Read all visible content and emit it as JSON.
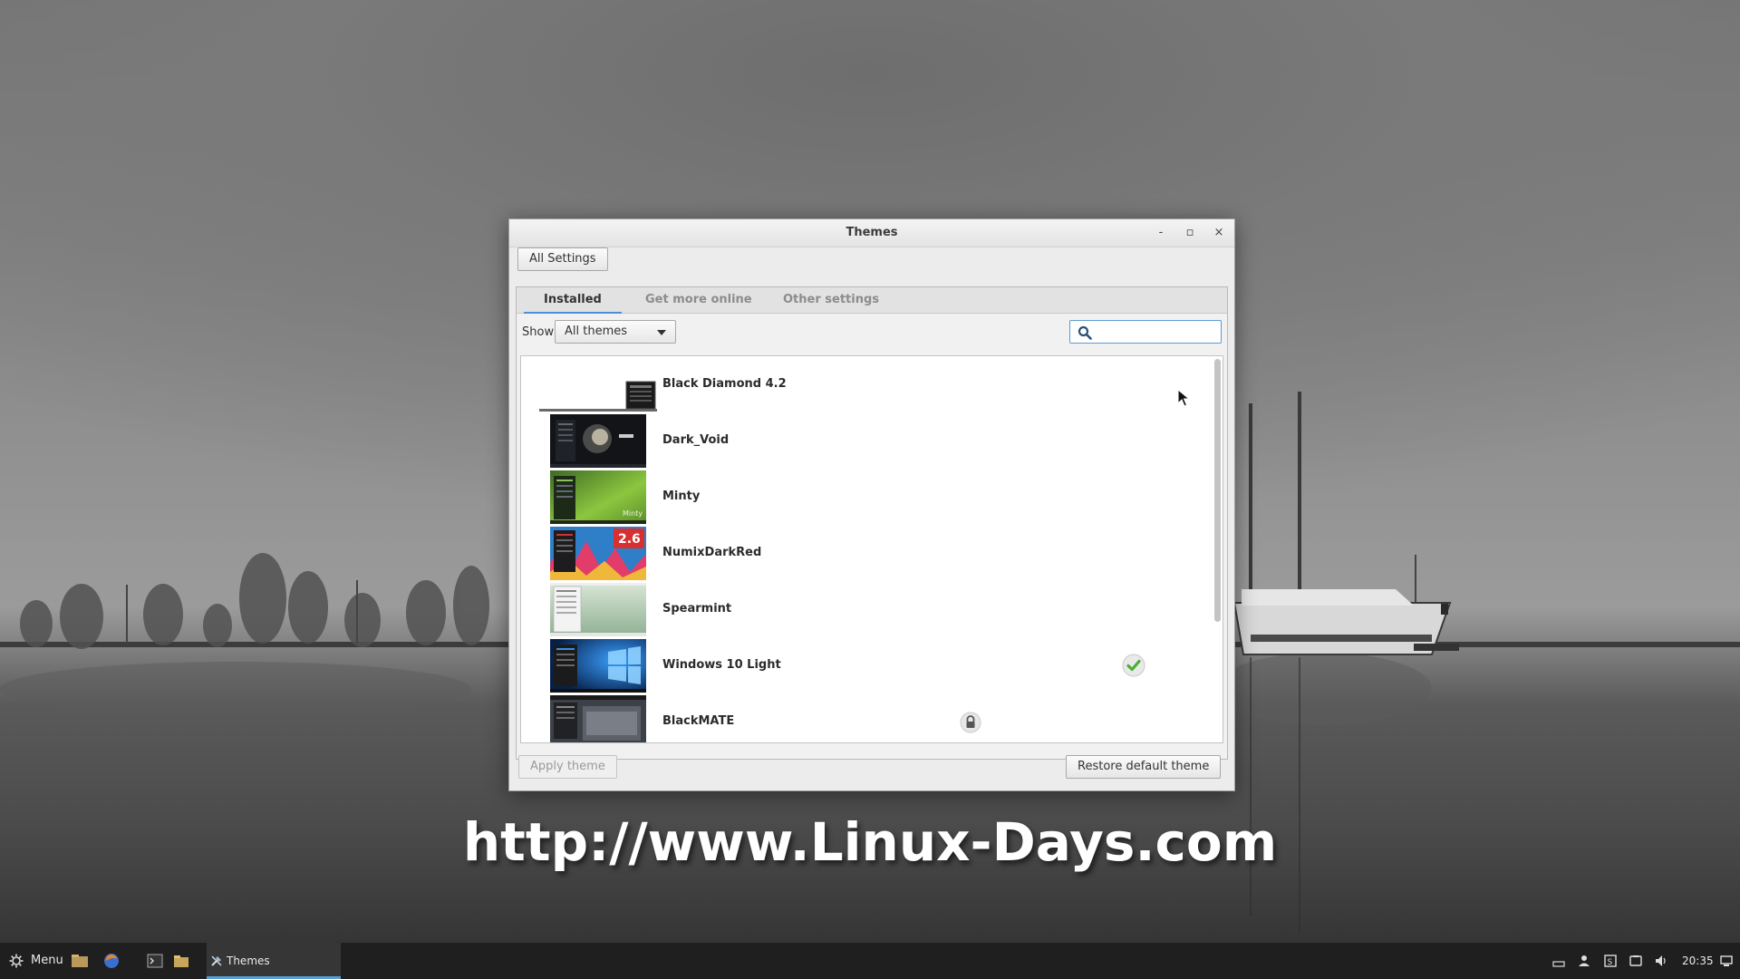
{
  "window": {
    "title": "Themes",
    "minimize_label": "-",
    "maximize_label": "▫",
    "close_label": "×"
  },
  "toolbar": {
    "all_settings_label": "All Settings"
  },
  "tabs": [
    {
      "label": "Installed",
      "active": true
    },
    {
      "label": "Get more online",
      "active": false
    },
    {
      "label": "Other settings",
      "active": false
    }
  ],
  "filter": {
    "show_label": "Show",
    "selected": "All themes"
  },
  "search": {
    "placeholder": "",
    "value": "",
    "icon": "search-icon"
  },
  "themes": [
    {
      "name": "Black Diamond 4.2",
      "status": ""
    },
    {
      "name": "Dark_Void",
      "status": ""
    },
    {
      "name": "Minty",
      "status": "",
      "thumb_text": "Minty"
    },
    {
      "name": "NumixDarkRed",
      "status": "",
      "thumb_text": "2.6"
    },
    {
      "name": "Spearmint",
      "status": ""
    },
    {
      "name": "Windows 10 Light",
      "status": "active",
      "status_icon": "checkmark-icon"
    },
    {
      "name": "BlackMATE",
      "status": "locked",
      "status_icon": "lock-icon"
    }
  ],
  "footer": {
    "apply_label": "Apply theme",
    "restore_label": "Restore default theme"
  },
  "watermark": "http://www.Linux-Days.com",
  "taskbar": {
    "menu_label": "Menu",
    "window_label": "Themes",
    "clock": "20:35"
  },
  "colors": {
    "accent": "#4a90d9",
    "taskbar_bg": "#1f1f1f",
    "check_green": "#4caf2f"
  }
}
